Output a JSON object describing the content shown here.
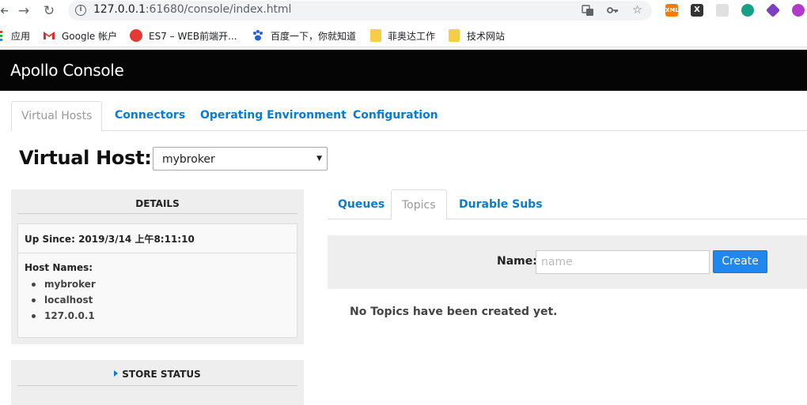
{
  "browser": {
    "url_host": "127.0.0.1",
    "url_rest": ":61680/console/index.html",
    "extensions": [
      {
        "name": "xml-extension-icon",
        "label": "XML",
        "color": "#f57c00"
      },
      {
        "name": "x-extension-icon",
        "label": "X",
        "color": "#333333"
      },
      {
        "name": "grid-extension-icon",
        "label": "",
        "color": "#e0e0e0"
      },
      {
        "name": "shield-extension-icon",
        "label": "",
        "color": "#16a085"
      },
      {
        "name": "cube-extension-icon",
        "label": "",
        "color": "#7b3fbf"
      },
      {
        "name": "circle-extension-icon",
        "label": "",
        "color": "#b03ac9"
      }
    ]
  },
  "bookmarks": [
    {
      "label": "应用"
    },
    {
      "label": "Google 帐户"
    },
    {
      "label": "ES7 – WEB前端开..."
    },
    {
      "label": "百度一下，你就知道"
    },
    {
      "label": "菲奥达工作"
    },
    {
      "label": "技术网站"
    }
  ],
  "app": {
    "title": "Apollo Console"
  },
  "top_tabs": [
    {
      "label": "Virtual Hosts",
      "active": true
    },
    {
      "label": "Connectors",
      "active": false
    },
    {
      "label": "Operating Environment",
      "active": false
    },
    {
      "label": "Configuration",
      "active": false
    }
  ],
  "virtual_host": {
    "label": "Virtual Host:",
    "selected": "mybroker"
  },
  "details": {
    "heading": "DETAILS",
    "up_since_label": "Up Since:",
    "up_since_value": "2019/3/14 上午8:11:10",
    "host_names_label": "Host Names:",
    "host_names": [
      "mybroker",
      "localhost",
      "127.0.0.1"
    ]
  },
  "store_status": {
    "heading": "STORE STATUS"
  },
  "sub_tabs": [
    {
      "label": "Queues",
      "active": false
    },
    {
      "label": "Topics",
      "active": true
    },
    {
      "label": "Durable Subs",
      "active": false
    }
  ],
  "create_form": {
    "name_label": "Name:",
    "name_placeholder": "name",
    "create_button": "Create"
  },
  "empty_message": "No Topics have been created yet.",
  "colors": {
    "link": "#0b7ad1",
    "header_bg": "#050505",
    "button": "#1f87ee"
  }
}
